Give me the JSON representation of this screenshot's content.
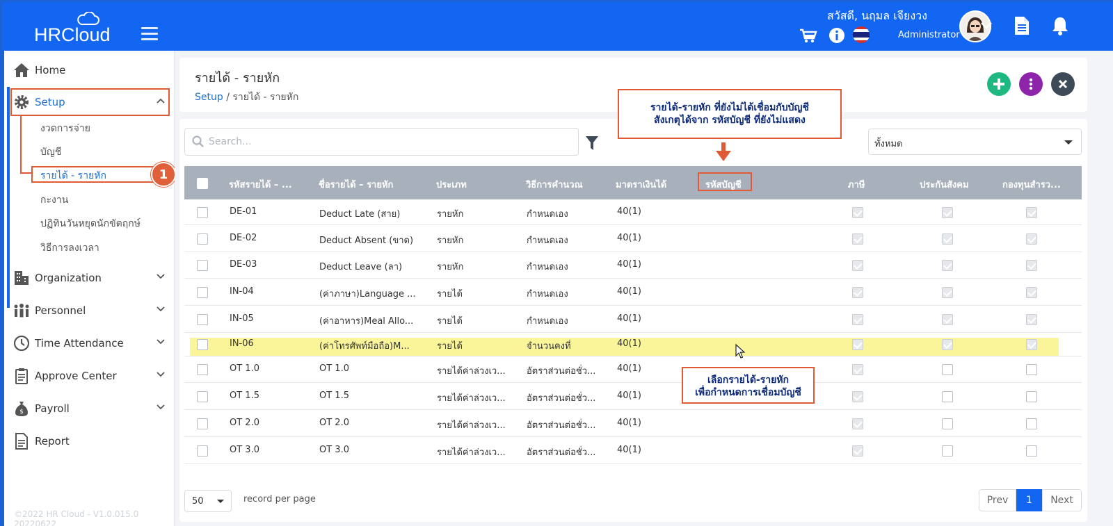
{
  "app": {
    "name": "HRCloud",
    "greeting": "สวัสดี, นฤมล เจียงวง",
    "role": "Administrator"
  },
  "sidebar": {
    "items": [
      {
        "label": "Home",
        "icon": "home-icon"
      },
      {
        "label": "Setup",
        "icon": "gear-icon"
      },
      {
        "label": "Organization",
        "icon": "building-icon"
      },
      {
        "label": "Personnel",
        "icon": "people-icon"
      },
      {
        "label": "Time Attendance",
        "icon": "clock-icon"
      },
      {
        "label": "Approve Center",
        "icon": "clipboard-icon"
      },
      {
        "label": "Payroll",
        "icon": "money-bag-icon"
      },
      {
        "label": "Report",
        "icon": "document-icon"
      }
    ],
    "setup_sub": [
      "งวดการจ่าย",
      "บัญชี",
      "รายได้ - รายหัก",
      "กะงาน",
      "ปฏิทินวันหยุดนักขัตฤกษ์",
      "วิธีการลงเวลา"
    ],
    "step_badge": "1",
    "copyright": "©2022 HR Cloud - V1.0.015.0 20220622"
  },
  "page": {
    "title": "รายได้ - รายหัก",
    "breadcrumb_root": "Setup",
    "breadcrumb_sep": "/",
    "breadcrumb_current": "รายได้ - รายหัก"
  },
  "toolbar": {
    "search_placeholder": "Search...",
    "filter_value": "ทั้งหมด"
  },
  "callouts": {
    "top_line1": "รายได้-รายหัก ที่ยังไม่ได้เชื่อมกับบัญชี",
    "top_line2": "สังเกตุได้จาก รหัสบัญชี ที่ยังไม่แสดง",
    "bottom_line1": "เลือกรายได้-รายหัก",
    "bottom_line2": "เพื่อกำหนดการเชื่อมบัญชี"
  },
  "table": {
    "columns": [
      "รหัสรายได้ – ...",
      "ชื่อรายได้ – รายหัก",
      "ประเภท",
      "วิธีการคำนวณ",
      "มาตราเงินได้",
      "รหัสบัญชี",
      "ภาษี",
      "ประกันสังคม",
      "กองทุนสำรว..."
    ],
    "rows": [
      {
        "code": "DE-01",
        "name": "Deduct Late (สาย)",
        "type": "รายหัก",
        "calc": "กำหนดเอง",
        "section": "40(1)",
        "account": "",
        "tax": true,
        "sso": true,
        "fund": true
      },
      {
        "code": "DE-02",
        "name": "Deduct Absent (ขาด)",
        "type": "รายหัก",
        "calc": "กำหนดเอง",
        "section": "40(1)",
        "account": "",
        "tax": true,
        "sso": true,
        "fund": true
      },
      {
        "code": "DE-03",
        "name": "Deduct Leave (ลา)",
        "type": "รายหัก",
        "calc": "กำหนดเอง",
        "section": "40(1)",
        "account": "",
        "tax": true,
        "sso": true,
        "fund": true
      },
      {
        "code": "IN-04",
        "name": "(ค่าภาษา)Language ...",
        "type": "รายได้",
        "calc": "กำหนดเอง",
        "section": "40(1)",
        "account": "",
        "tax": true,
        "sso": true,
        "fund": true
      },
      {
        "code": "IN-05",
        "name": "(ค่าอาหาร)Meal Allo...",
        "type": "รายได้",
        "calc": "กำหนดเอง",
        "section": "40(1)",
        "account": "",
        "tax": true,
        "sso": true,
        "fund": true
      },
      {
        "code": "IN-06",
        "name": "(ค่าโทรศัพท์มือถือ)M...",
        "type": "รายได้",
        "calc": "จำนวนคงที่",
        "section": "40(1)",
        "account": "",
        "tax": true,
        "sso": true,
        "fund": true
      },
      {
        "code": "OT 1.0",
        "name": "OT 1.0",
        "type": "รายได้ค่าล่วงเว...",
        "calc": "อัตราส่วนต่อชั่ว...",
        "section": "40(1)",
        "account": "",
        "tax": true,
        "sso": false,
        "fund": false
      },
      {
        "code": "OT 1.5",
        "name": "OT 1.5",
        "type": "รายได้ค่าล่วงเว...",
        "calc": "อัตราส่วนต่อชั่ว...",
        "section": "40(1)",
        "account": "",
        "tax": true,
        "sso": false,
        "fund": false
      },
      {
        "code": "OT 2.0",
        "name": "OT 2.0",
        "type": "รายได้ค่าล่วงเว...",
        "calc": "อัตราส่วนต่อชั่ว...",
        "section": "40(1)",
        "account": "",
        "tax": true,
        "sso": false,
        "fund": false
      },
      {
        "code": "OT 3.0",
        "name": "OT 3.0",
        "type": "รายได้ค่าล่วงเว...",
        "calc": "อัตราส่วนต่อชั่ว...",
        "section": "40(1)",
        "account": "",
        "tax": true,
        "sso": false,
        "fund": false
      }
    ]
  },
  "footer": {
    "per_page": "50",
    "per_page_label": "record per page",
    "prev": "Prev",
    "page": "1",
    "next": "Next"
  },
  "colors": {
    "brand_blue": "#1266f1",
    "accent_red": "#e05a36",
    "add_green": "#1eb980",
    "more_purple": "#8e24aa",
    "close_dark": "#3d4a57",
    "highlight_yellow": "#fbf59a"
  }
}
